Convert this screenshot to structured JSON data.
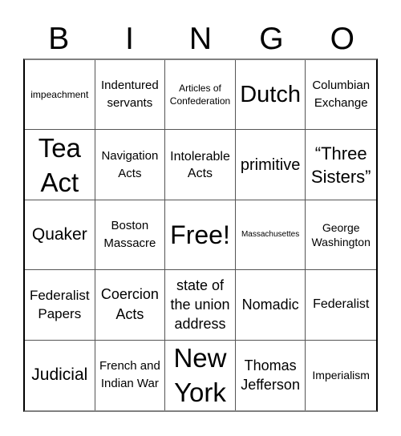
{
  "header": {
    "letters": [
      "B",
      "I",
      "N",
      "G",
      "O"
    ]
  },
  "board": {
    "rows": [
      [
        "impeachment",
        "Indentured servants",
        "Articles of Confederation",
        "Dutch",
        "Columbian Exchange"
      ],
      [
        "Tea Act",
        "Navigation Acts",
        "Intolerable Acts",
        "primitive",
        "“Three Sisters”"
      ],
      [
        "Quaker",
        "Boston Massacre",
        "Free!",
        "Massachusettes",
        "George Washington"
      ],
      [
        "Federalist Papers",
        "Coercion Acts",
        "state of the union address",
        "Nomadic",
        "Federalist"
      ],
      [
        "Judicial",
        "French and Indian War",
        "New York",
        "Thomas Jefferson",
        "Imperialism"
      ]
    ],
    "free_space": "Free!"
  },
  "colors": {
    "background": "#ffffff",
    "text": "#000000",
    "grid_line": "#555555"
  }
}
